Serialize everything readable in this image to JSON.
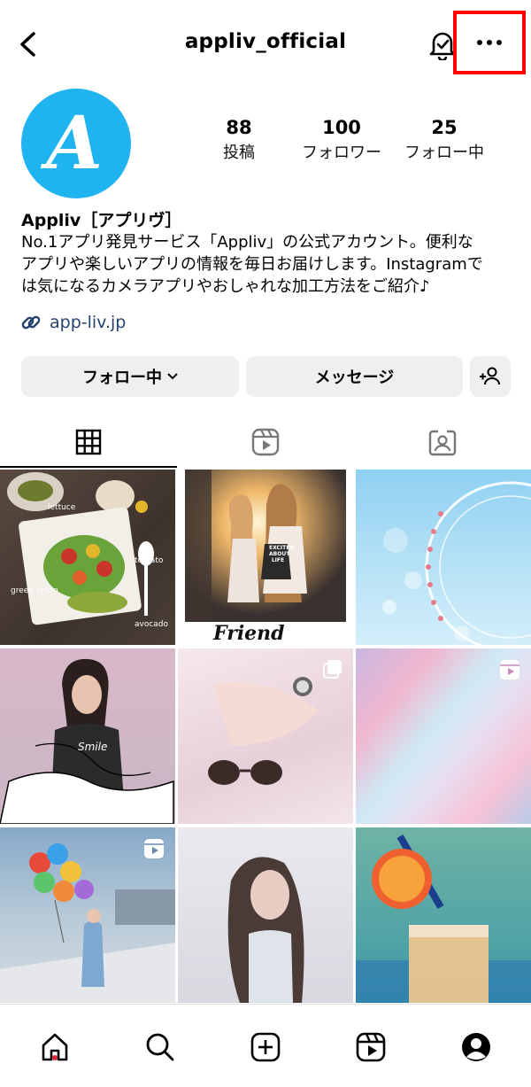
{
  "header": {
    "username": "appliv_official"
  },
  "profile": {
    "avatar_letter": "A",
    "stats": [
      {
        "value": "88",
        "label": "投稿"
      },
      {
        "value": "100",
        "label": "フォロワー"
      },
      {
        "value": "25",
        "label": "フォロー中"
      }
    ],
    "display_name": "Appliv［アプリヴ］",
    "bio_lines": [
      "No.1アプリ発見サービス「Appliv」の公式アカウント。便利な",
      "アプリや楽しいアプリの情報を毎日お届けします。Instagramで",
      "は気になるカメラアプリやおしゃれな加工方法をご紹介♪"
    ],
    "link": "app-liv.jp"
  },
  "actions": {
    "following_label": "フォロー中",
    "message_label": "メッセージ"
  },
  "tabs": [
    "grid-icon",
    "reels-icon",
    "tagged-icon"
  ],
  "grid": {
    "posts": [
      {
        "label_words": [
          "lettuce",
          "tomato",
          "green onion",
          "avocado"
        ]
      },
      {
        "shirt_text": [
          "EXCITED",
          "ABOUT",
          "LIFE"
        ],
        "caption": "Friend"
      },
      {},
      {
        "shirt_text": "Smile"
      },
      {},
      {},
      {},
      {},
      {}
    ]
  },
  "colors": {
    "accent_red": "#ff0000",
    "avatar_blue": "#1fb4ef",
    "link_blue": "#25436f",
    "button_gray": "#efefef",
    "notify_dot": "#e4253a"
  }
}
